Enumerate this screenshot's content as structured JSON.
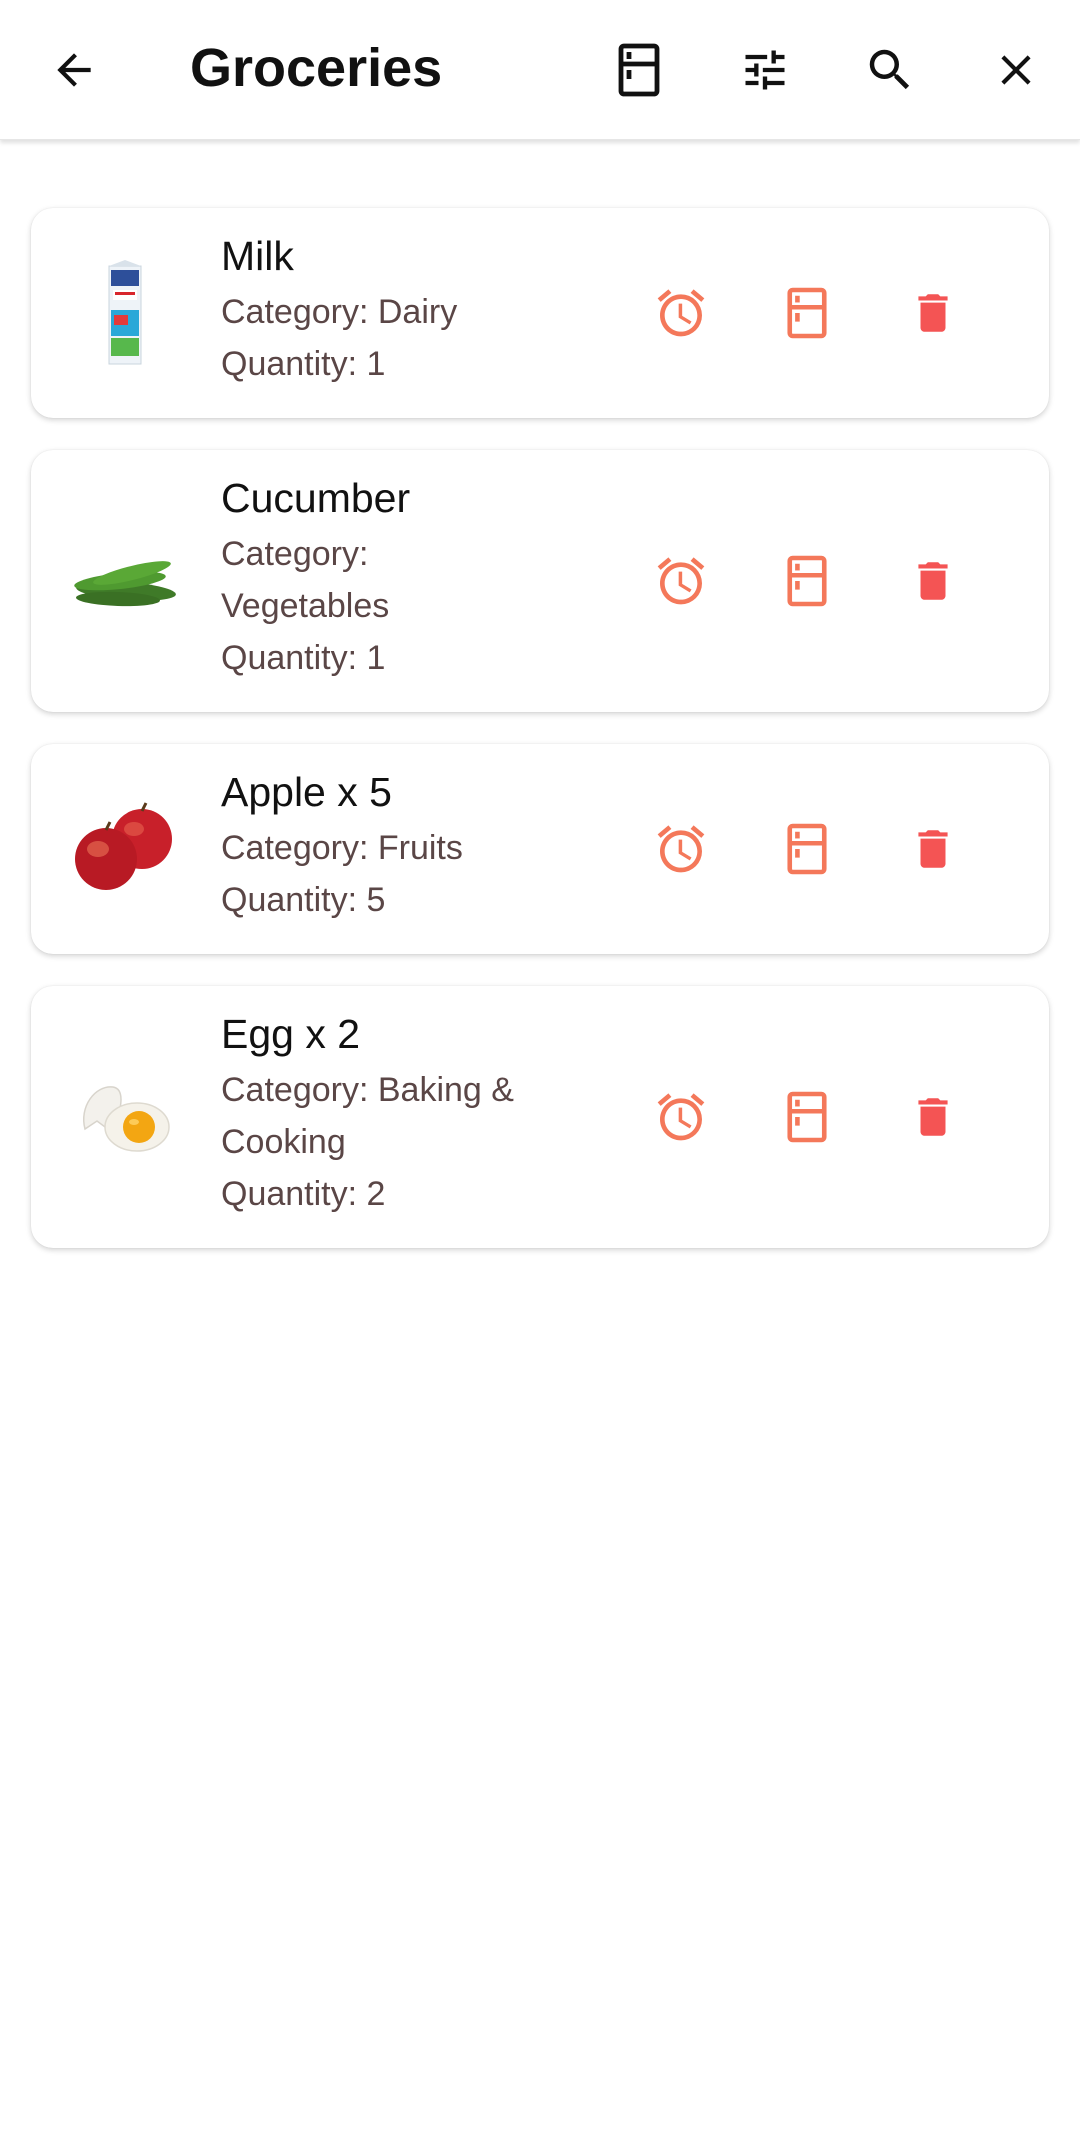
{
  "header": {
    "title": "Groceries",
    "back_icon": "arrow-back-icon",
    "fridge_icon": "fridge-icon",
    "filter_icon": "tune-icon",
    "search_icon": "search-icon",
    "close_icon": "close-icon"
  },
  "colors": {
    "action_icon": "#f4785a",
    "delete_icon": "#f45454",
    "secondary_text": "#5a4646"
  },
  "items": [
    {
      "name": "Milk",
      "category": "Category: Dairy",
      "quantity": "Quantity: 1",
      "image": "milk-carton-image"
    },
    {
      "name": "Cucumber",
      "category": "Category: Vegetables",
      "quantity": "Quantity: 1",
      "image": "cucumbers-image"
    },
    {
      "name": "Apple x 5",
      "category": "Category: Fruits",
      "quantity": "Quantity: 5",
      "image": "apples-image"
    },
    {
      "name": "Egg x 2",
      "category": "Category: Baking & Cooking",
      "quantity": "Quantity: 2",
      "image": "cracked-egg-image"
    }
  ]
}
